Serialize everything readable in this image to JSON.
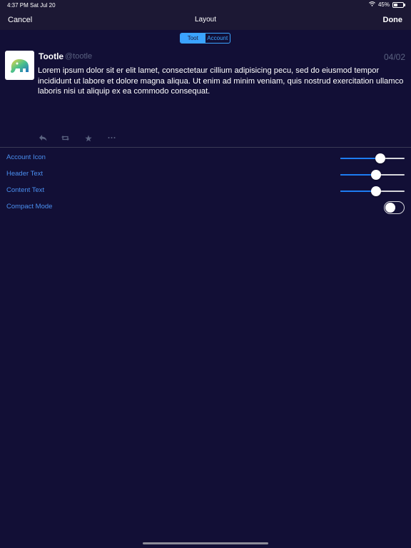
{
  "status_bar": {
    "time": "4:37 PM",
    "date": "Sat Jul 20",
    "battery_text": "45%",
    "battery_level": 0.45
  },
  "nav": {
    "cancel": "Cancel",
    "title": "Layout",
    "done": "Done"
  },
  "segmented": {
    "options": [
      "Toot",
      "Account"
    ],
    "selected": "Toot"
  },
  "post": {
    "name": "Tootle",
    "handle": "@tootle",
    "date": "04/02",
    "body": "Lorem ipsum dolor sit er elit lamet, consectetaur cillium adipisicing pecu, sed do eiusmod tempor incididunt ut labore et dolore magna aliqua. Ut enim ad minim veniam, quis nostrud exercitation ullamco laboris nisi ut aliquip ex ea commodo consequat.",
    "actions": [
      "reply-icon",
      "boost-icon",
      "favorite-icon",
      "more-icon"
    ]
  },
  "settings": {
    "account_icon": {
      "label": "Account Icon",
      "value": 0.62
    },
    "header_text": {
      "label": "Header Text",
      "value": 0.55
    },
    "content_text": {
      "label": "Content Text",
      "value": 0.56
    },
    "compact_mode": {
      "label": "Compact Mode",
      "on": false
    }
  },
  "colors": {
    "background": "#120f36",
    "bar": "#1c1834",
    "accent": "#3ba3ff",
    "label": "#4a8ff0",
    "muted": "#5a6280"
  }
}
